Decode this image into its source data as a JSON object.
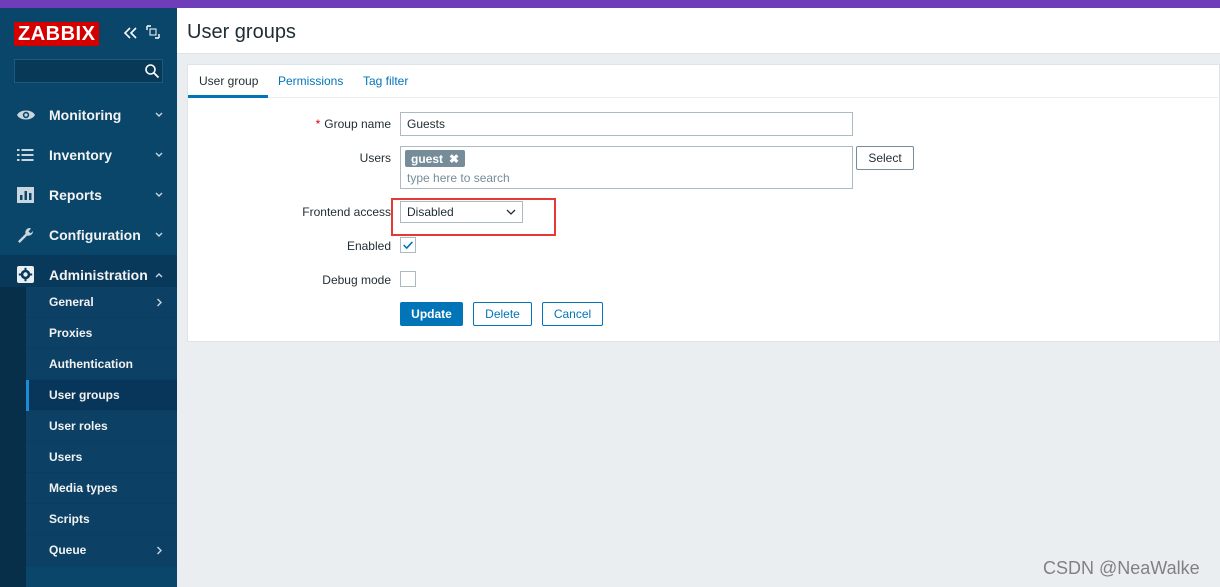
{
  "app": {
    "logo": "ZABBIX",
    "brand_color": "#d40000",
    "top_bar_color": "#6f3dba",
    "sidebar_color": "#0a466a"
  },
  "sidebar": {
    "search": {
      "value": "",
      "placeholder": ""
    },
    "menu": [
      {
        "label": "Monitoring",
        "icon": "eye-icon",
        "chevron": "down"
      },
      {
        "label": "Inventory",
        "icon": "list-icon",
        "chevron": "down"
      },
      {
        "label": "Reports",
        "icon": "bar-chart-icon",
        "chevron": "down"
      },
      {
        "label": "Configuration",
        "icon": "wrench-icon",
        "chevron": "down"
      },
      {
        "label": "Administration",
        "icon": "gear-icon",
        "chevron": "up",
        "active": true
      }
    ],
    "submenu": [
      {
        "label": "General",
        "chevron": "right"
      },
      {
        "label": "Proxies"
      },
      {
        "label": "Authentication"
      },
      {
        "label": "User groups",
        "selected": true
      },
      {
        "label": "User roles"
      },
      {
        "label": "Users"
      },
      {
        "label": "Media types"
      },
      {
        "label": "Scripts"
      },
      {
        "label": "Queue",
        "chevron": "right"
      }
    ]
  },
  "header": {
    "title": "User groups"
  },
  "tabs": [
    {
      "label": "User group",
      "active": true
    },
    {
      "label": "Permissions"
    },
    {
      "label": "Tag filter"
    }
  ],
  "form": {
    "group_name": {
      "label": "Group name",
      "required_mark": "*",
      "value": "Guests"
    },
    "users": {
      "label": "Users",
      "chips": [
        "guest"
      ],
      "placeholder": "type here to search",
      "select_button": "Select"
    },
    "frontend_access": {
      "label": "Frontend access",
      "value": "Disabled"
    },
    "enabled": {
      "label": "Enabled",
      "checked": true
    },
    "debug_mode": {
      "label": "Debug mode",
      "checked": false
    }
  },
  "buttons": {
    "update": "Update",
    "delete": "Delete",
    "cancel": "Cancel"
  },
  "watermark": "CSDN @NeaWalke"
}
